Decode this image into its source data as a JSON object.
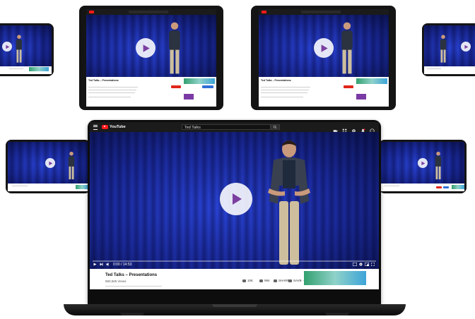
{
  "laptop": {
    "brand": "YouTube",
    "search_value": "Ted Talks",
    "video_title": "Ted Talks – Presentations",
    "views": "850,565 Views",
    "time": "0:00 / 14:53",
    "actions": [
      {
        "label": "10K"
      },
      {
        "label": "994"
      },
      {
        "label": "SHARE"
      },
      {
        "label": "SAVE"
      }
    ]
  },
  "tablet_left": {
    "title": "Ted Talks – Presentations"
  },
  "tablet_right": {
    "title": "Ted Talks – Presentations"
  },
  "colors": {
    "stage_blue": "#1a2a9a",
    "play_triangle": "#7b3fa0",
    "yt_red": "#ff1a1a",
    "subscribe_red": "#e1251b",
    "info_blue": "#2f6fd6"
  }
}
